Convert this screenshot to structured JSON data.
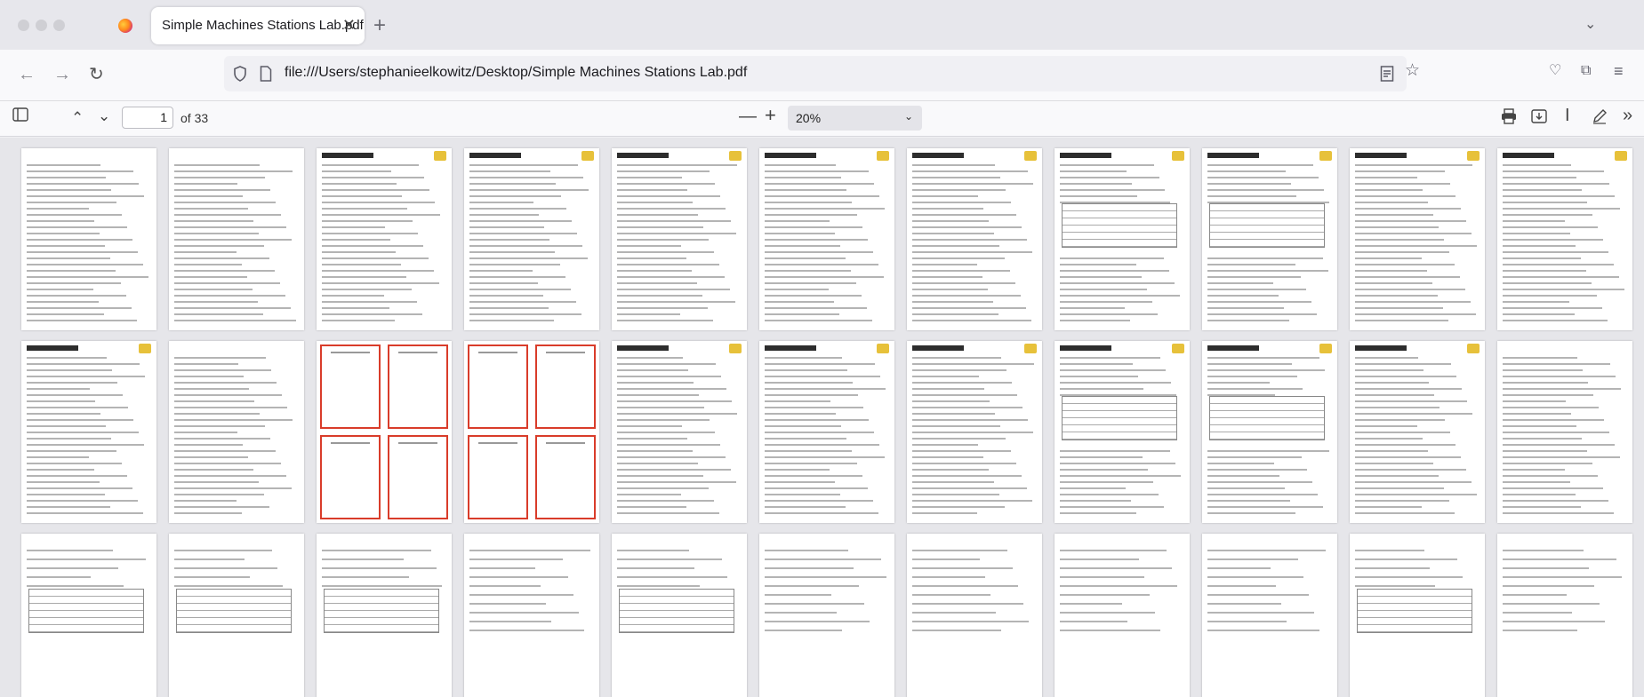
{
  "tab": {
    "title": "Simple Machines Stations Lab.pdf",
    "close": "✕"
  },
  "nav": {
    "back": "←",
    "forward": "→",
    "reload": "↻",
    "url": "file:///Users/stephanieelkowitz/Desktop/Simple Machines Stations Lab.pdf"
  },
  "pdf_toolbar": {
    "sidebar_toggle": "▯",
    "page_current": "1",
    "page_total_label": "of 33",
    "zoom_out": "—",
    "zoom_in": "+",
    "zoom_value": "20%"
  },
  "icons": {
    "tab_firefox": "firefox-icon",
    "tab_new": "plus-icon",
    "tab_list": "chevron-down-icon",
    "shield": "shield-icon",
    "page": "page-icon",
    "reader": "reader-view-icon",
    "bookmark": "star-icon",
    "pocket": "pocket-icon",
    "extensions": "extensions-icon",
    "menu": "hamburger-icon",
    "print": "print-icon",
    "download": "download-icon",
    "text_select": "text-cursor-icon",
    "draw": "pen-icon",
    "more": "double-chevron-icon"
  },
  "viewer": {
    "pages_visible": 33,
    "columns": 11,
    "rows": 3
  },
  "colors": {
    "accent_red": "#d93c2a",
    "header_yellow": "#e7c13a"
  }
}
